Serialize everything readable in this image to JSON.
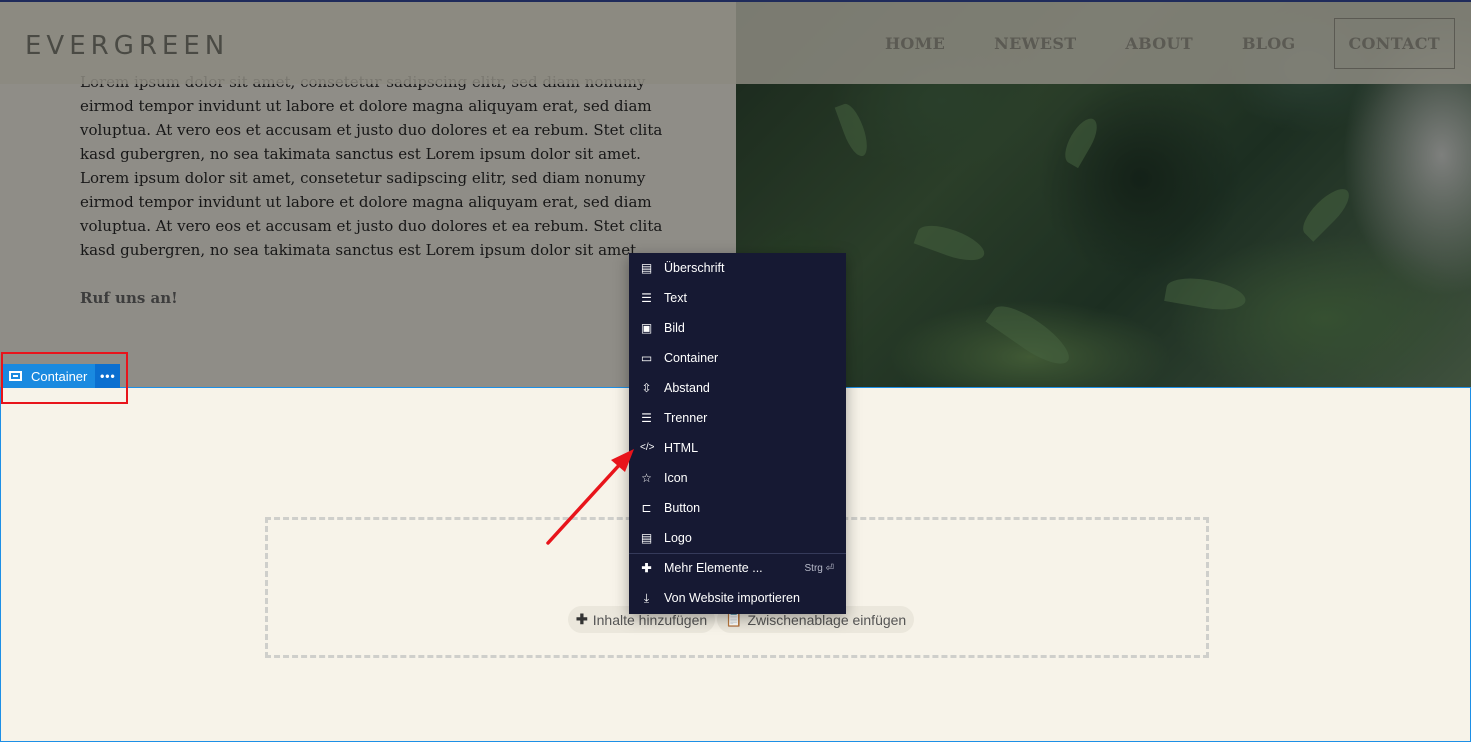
{
  "header": {
    "logo": "EVERGREEN",
    "nav": [
      "HOME",
      "NEWEST",
      "ABOUT",
      "BLOG"
    ],
    "nav_cta": "CONTACT"
  },
  "hero": {
    "paragraph": "Lorem ipsum dolor sit amet, consetetur sadipscing elitr, sed diam nonumy eirmod tempor invidunt ut labore et dolore magna aliquyam erat, sed diam voluptua. At vero eos et accusam et justo duo dolores et ea rebum. Stet clita kasd gubergren, no sea takimata sanctus est Lorem ipsum dolor sit amet. Lorem ipsum dolor sit amet, consetetur sadipscing elitr, sed diam nonumy eirmod tempor invidunt ut labore et dolore magna aliquyam erat, sed diam voluptua. At vero eos et accusam et justo duo dolores et ea rebum. Stet clita kasd gubergren, no sea takimata sanctus est Lorem ipsum dolor sit amet.",
    "cta": "Ruf uns an!"
  },
  "container_badge": {
    "label": "Container",
    "more": "•••"
  },
  "section": {
    "add_content": "Inhalte hinzufügen",
    "paste_clipboard": "Zwischenablage einfügen"
  },
  "menu": {
    "items": [
      {
        "label": "Überschrift",
        "icon": "heading-icon"
      },
      {
        "label": "Text",
        "icon": "text-lines-icon"
      },
      {
        "label": "Bild",
        "icon": "image-icon"
      },
      {
        "label": "Container",
        "icon": "container-icon"
      },
      {
        "label": "Abstand",
        "icon": "spacing-icon"
      },
      {
        "label": "Trenner",
        "icon": "divider-icon"
      },
      {
        "label": "HTML",
        "icon": "code-icon"
      },
      {
        "label": "Icon",
        "icon": "star-icon"
      },
      {
        "label": "Button",
        "icon": "button-icon"
      },
      {
        "label": "Logo",
        "icon": "logo-card-icon"
      }
    ],
    "more_elements": "Mehr Elemente ...",
    "more_shortcut": "Strg ⏎",
    "import": "Von Website importieren"
  },
  "colors": {
    "menu_bg": "#161933",
    "selection_blue": "#1a8ae0",
    "annotation_red": "#e8141b",
    "section_bg": "#f7f3e9"
  }
}
